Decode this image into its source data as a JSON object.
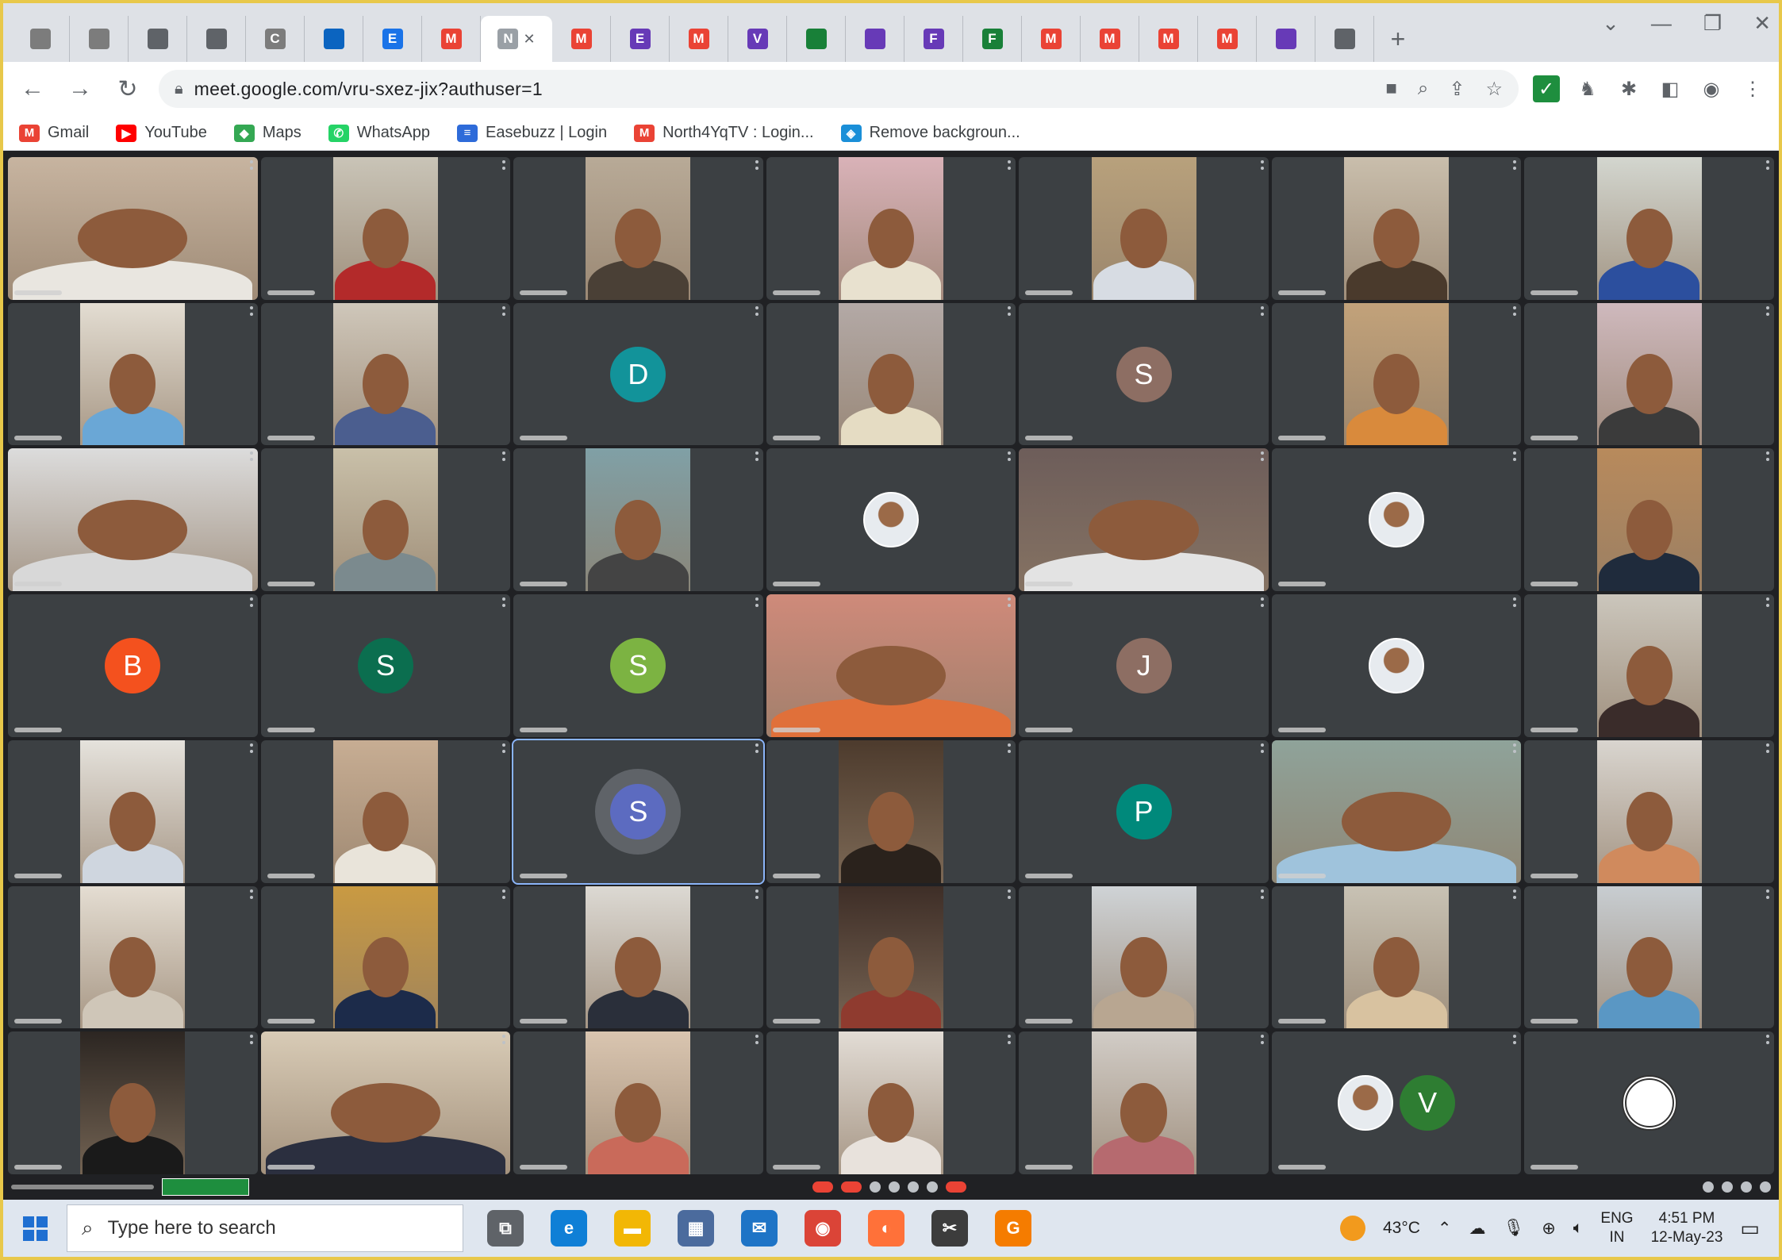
{
  "browser": {
    "tabs": [
      {
        "icon": "tab-icon",
        "label": "",
        "color": "#7c7c7c"
      },
      {
        "icon": "tab-icon",
        "label": "",
        "color": "#7c7c7c"
      },
      {
        "icon": "chrome-icon",
        "label": "",
        "color": "#5f6368"
      },
      {
        "icon": "chrome-icon",
        "label": "",
        "color": "#5f6368"
      },
      {
        "icon": "tab-icon",
        "label": "C",
        "color": "#7c7c7c"
      },
      {
        "icon": "outlook-icon",
        "label": "",
        "color": "#0b64c0"
      },
      {
        "icon": "list-icon",
        "label": "E",
        "color": "#1a73e8"
      },
      {
        "icon": "gmail-icon",
        "label": "M",
        "color": "#ea4335"
      },
      {
        "icon": "meet-icon",
        "label": "N",
        "color": "#9aa0a6"
      },
      {
        "icon": "gmail-icon",
        "label": "M",
        "color": "#ea4335"
      },
      {
        "icon": "forms-icon",
        "label": "E",
        "color": "#673ab7"
      },
      {
        "icon": "gmail-icon",
        "label": "M",
        "color": "#ea4335"
      },
      {
        "icon": "forms-icon",
        "label": "V",
        "color": "#673ab7"
      },
      {
        "icon": "sheets-icon",
        "label": "",
        "color": "#188038"
      },
      {
        "icon": "forms-icon",
        "label": "",
        "color": "#673ab7"
      },
      {
        "icon": "forms-icon",
        "label": "F",
        "color": "#673ab7"
      },
      {
        "icon": "sheets-icon",
        "label": "F",
        "color": "#188038"
      },
      {
        "icon": "gmail-icon",
        "label": "M",
        "color": "#ea4335"
      },
      {
        "icon": "gmail-icon",
        "label": "M",
        "color": "#ea4335"
      },
      {
        "icon": "gmail-icon",
        "label": "M",
        "color": "#ea4335"
      },
      {
        "icon": "gmail-icon",
        "label": "M",
        "color": "#ea4335"
      },
      {
        "icon": "forms-icon",
        "label": "",
        "color": "#673ab7"
      },
      {
        "icon": "chrome-icon",
        "label": "",
        "color": "#5f6368"
      }
    ],
    "active_tab_index": 8,
    "new_tab": "+",
    "window_controls": {
      "dropdown": "⌄",
      "minimize": "—",
      "restore": "❐",
      "close": "✕"
    },
    "nav": {
      "back": "←",
      "forward": "→",
      "reload": "↻"
    },
    "url": "meet.google.com/vru-sxez-jix?authuser=1",
    "bookmarks": [
      {
        "label": "Gmail",
        "icon": "gmail-icon",
        "color": "#ea4335",
        "glyph": "M"
      },
      {
        "label": "YouTube",
        "icon": "youtube-icon",
        "color": "#ff0000",
        "glyph": "▶"
      },
      {
        "label": "Maps",
        "icon": "maps-icon",
        "color": "#34a853",
        "glyph": "◆"
      },
      {
        "label": "WhatsApp",
        "icon": "whatsapp-icon",
        "color": "#25d366",
        "glyph": "✆"
      },
      {
        "label": "Easebuzz | Login",
        "icon": "easebuzz-icon",
        "color": "#2e6bd9",
        "glyph": "≡"
      },
      {
        "label": "North4YqTV : Login...",
        "icon": "gmail-icon",
        "color": "#ea4335",
        "glyph": "M"
      },
      {
        "label": "Remove backgroun...",
        "icon": "removebg-icon",
        "color": "#1a8fd8",
        "glyph": "◈"
      }
    ]
  },
  "meet": {
    "tiles": [
      {
        "type": "video",
        "wide": true,
        "shirt": "#e9e6e0",
        "bg": "#c7b4a0"
      },
      {
        "type": "video",
        "shirt": "#b32a2a",
        "bg": "#c9c4b7"
      },
      {
        "type": "video",
        "shirt": "#4a4036",
        "bg": "#b8aa97"
      },
      {
        "type": "video",
        "shirt": "#e8e1cf",
        "bg": "#d9b2b8"
      },
      {
        "type": "video",
        "shirt": "#d7dce3",
        "bg": "#b8a17c"
      },
      {
        "type": "video",
        "shirt": "#4a3a2c",
        "bg": "#c9beac"
      },
      {
        "type": "video",
        "shirt": "#2c4f9e",
        "bg": "#d3d6cf"
      },
      {
        "type": "video",
        "shirt": "#6aa7d6",
        "bg": "#e3ddd2"
      },
      {
        "type": "video",
        "shirt": "#4b5e8f",
        "bg": "#cfc7ba"
      },
      {
        "type": "avatar",
        "letter": "D",
        "color": "#12939a"
      },
      {
        "type": "video",
        "shirt": "#e5dcc3",
        "bg": "#b3a9a6"
      },
      {
        "type": "avatar",
        "letter": "S",
        "color": "#8d6e63"
      },
      {
        "type": "video",
        "shirt": "#d98a3c",
        "bg": "#c2a27a"
      },
      {
        "type": "video",
        "shirt": "#3b3b3b",
        "bg": "#cfb9bd"
      },
      {
        "type": "video",
        "wide": true,
        "shirt": "#d8d8d8",
        "bg": "#dcdcdc"
      },
      {
        "type": "video",
        "shirt": "#7b8a8e",
        "bg": "#c9c0a9"
      },
      {
        "type": "video",
        "shirt": "#444444",
        "bg": "#80a0a6"
      },
      {
        "type": "photo-avatar"
      },
      {
        "type": "video",
        "wide": true,
        "shirt": "#e3e3e3",
        "bg": "#6d5d5a"
      },
      {
        "type": "photo-avatar"
      },
      {
        "type": "video",
        "shirt": "#1f2b3c",
        "bg": "#b88a5c"
      },
      {
        "type": "avatar",
        "letter": "B",
        "color": "#f4511e"
      },
      {
        "type": "avatar",
        "letter": "S",
        "color": "#0b6e4f"
      },
      {
        "type": "avatar",
        "letter": "S",
        "color": "#7cb342"
      },
      {
        "type": "video",
        "wide": true,
        "shirt": "#e0703a",
        "bg": "#cf8a7a"
      },
      {
        "type": "avatar",
        "letter": "J",
        "color": "#8d6e63"
      },
      {
        "type": "photo-avatar"
      },
      {
        "type": "video",
        "shirt": "#3a2c2a",
        "bg": "#cbc6bc"
      },
      {
        "type": "video",
        "shirt": "#cfd6df",
        "bg": "#e5e2dc"
      },
      {
        "type": "video",
        "shirt": "#e9e4da",
        "bg": "#c7ad93"
      },
      {
        "type": "avatar-ring",
        "letter": "S",
        "color": "#5c6bc0",
        "selected": true
      },
      {
        "type": "video",
        "shirt": "#2a221c",
        "bg": "#4d3b2d"
      },
      {
        "type": "avatar",
        "letter": "P",
        "color": "#00897b"
      },
      {
        "type": "video",
        "wide": true,
        "shirt": "#9fc3dc",
        "bg": "#8fa39a"
      },
      {
        "type": "video",
        "shirt": "#d08a5d",
        "bg": "#d9d5cf"
      },
      {
        "type": "video",
        "shirt": "#cfc6b8",
        "bg": "#e4ddd2"
      },
      {
        "type": "video",
        "shirt": "#1c2b4a",
        "bg": "#c99a42"
      },
      {
        "type": "video",
        "shirt": "#2a2f3a",
        "bg": "#dcd9d3"
      },
      {
        "type": "video",
        "shirt": "#8f3b2f",
        "bg": "#3e2e27"
      },
      {
        "type": "video",
        "shirt": "#b8a691",
        "bg": "#cfd3d6"
      },
      {
        "type": "video",
        "shirt": "#d8c2a0",
        "bg": "#c8c2b4"
      },
      {
        "type": "video",
        "shirt": "#5a97c4",
        "bg": "#c8cdd1"
      },
      {
        "type": "video",
        "shirt": "#1a1a1a",
        "bg": "#2c2622"
      },
      {
        "type": "video",
        "wide": true,
        "shirt": "#2b2f3f",
        "bg": "#d8cbb6"
      },
      {
        "type": "video",
        "shirt": "#c96a5a",
        "bg": "#d9c5b0"
      },
      {
        "type": "video",
        "shirt": "#e8e2dc",
        "bg": "#e2dcd5"
      },
      {
        "type": "video",
        "shirt": "#b66a6f",
        "bg": "#d1ccc6"
      },
      {
        "type": "avatar",
        "letter": "V",
        "color": "#2e7d32",
        "companion": true
      },
      {
        "type": "logo"
      }
    ]
  },
  "taskbar": {
    "search_placeholder": "Type here to search",
    "apps": [
      {
        "icon": "task-view-icon",
        "color": "#5f6368",
        "glyph": "⧉"
      },
      {
        "icon": "edge-icon",
        "color": "#0f7fd6",
        "glyph": "e"
      },
      {
        "icon": "file-explorer-icon",
        "color": "#f2b705",
        "glyph": "▬"
      },
      {
        "icon": "store-icon",
        "color": "#4b6b9d",
        "glyph": "▦"
      },
      {
        "icon": "mail-icon",
        "color": "#1e74c6",
        "glyph": "✉"
      },
      {
        "icon": "chrome-icon",
        "color": "#db4437",
        "glyph": "◉"
      },
      {
        "icon": "firefox-icon",
        "color": "#ff7139",
        "glyph": "◐"
      },
      {
        "icon": "snipping-icon",
        "color": "#3c3c3c",
        "glyph": "✂"
      },
      {
        "icon": "app-g-icon",
        "color": "#f57c00",
        "glyph": "G"
      }
    ],
    "weather": "43°C",
    "language_top": "ENG",
    "language_bottom": "IN",
    "time": "4:51 PM",
    "date": "12-May-23"
  }
}
